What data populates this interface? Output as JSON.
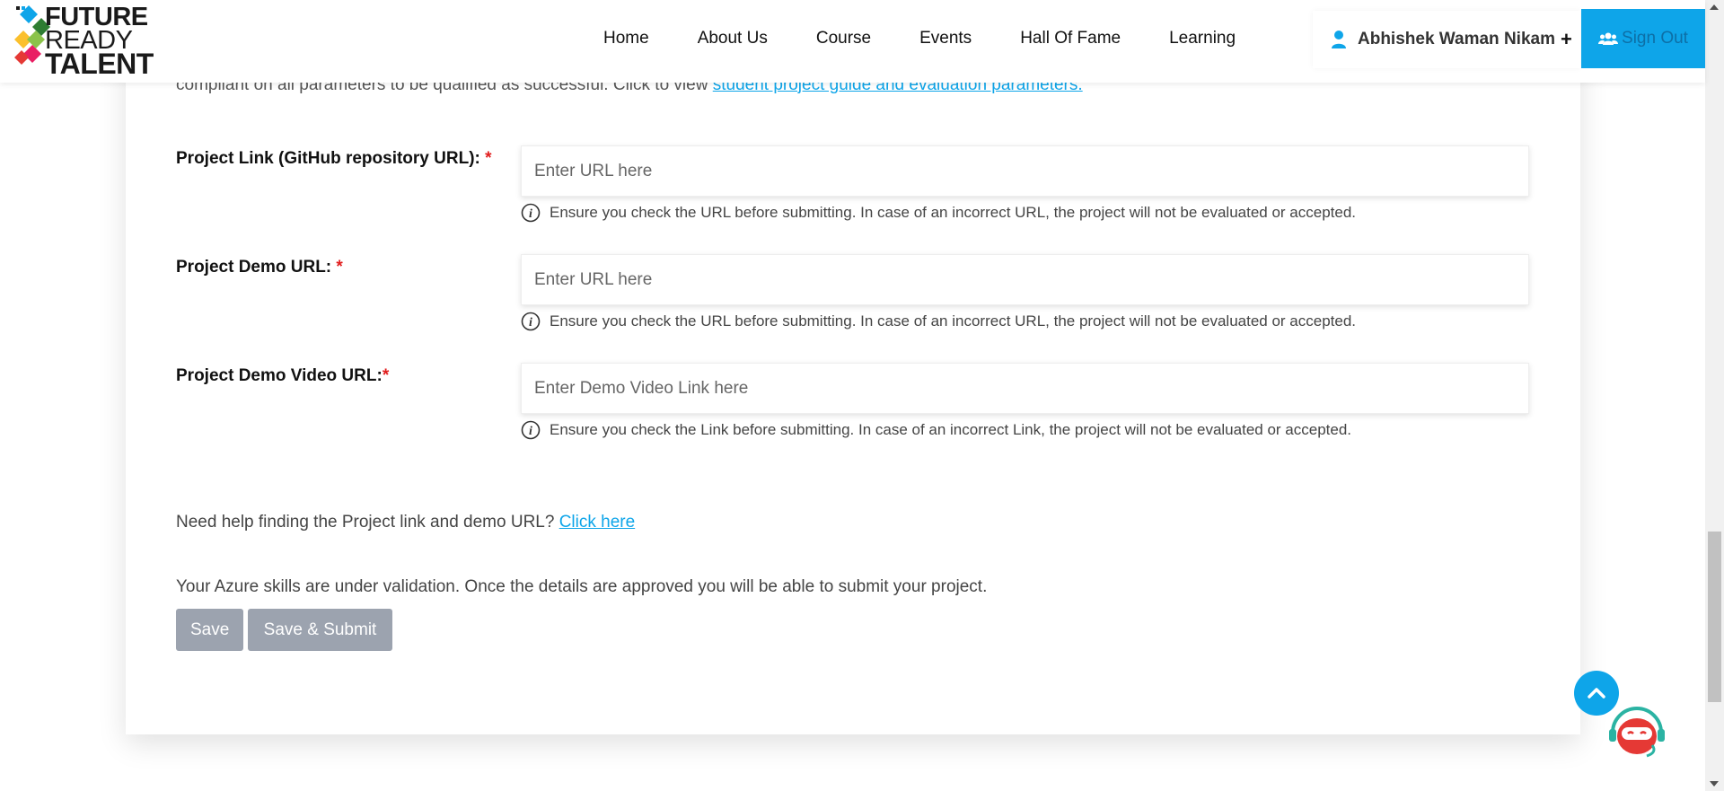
{
  "logo": {
    "line1": "FUTURE",
    "line2": "READY",
    "line3": "TALENT"
  },
  "nav": [
    "Home",
    "About Us",
    "Course",
    "Events",
    "Hall Of Fame",
    "Learning"
  ],
  "user": {
    "name": "Abhishek Waman Nikam",
    "plus": "+"
  },
  "signout": "Sign Out",
  "intro": {
    "text": "compliant on all parameters to be qualified as successful. Click to view ",
    "link": "student project guide and evaluation parameters."
  },
  "fields": [
    {
      "label": "Project Link (GitHub repository URL): ",
      "required": "*",
      "placeholder": "Enter URL here",
      "value": "",
      "hint": "Ensure you check the URL before submitting. In case of an incorrect URL, the project will not be evaluated or accepted."
    },
    {
      "label": "Project Demo URL: ",
      "required": "*",
      "placeholder": "Enter URL here",
      "value": "",
      "hint": "Ensure you check the URL before submitting. In case of an incorrect URL, the project will not be evaluated or accepted."
    },
    {
      "label": "Project Demo Video URL:",
      "required": "*",
      "placeholder": "Enter Demo Video Link here",
      "value": "",
      "hint": "Ensure you check the Link before submitting. In case of an incorrect Link, the project will not be evaluated or accepted."
    }
  ],
  "help": {
    "text": "Need help finding the Project link and demo URL? ",
    "link": "Click here"
  },
  "status": "Your Azure skills are under validation. Once the details are approved you will be able to submit your project.",
  "buttons": {
    "save": "Save",
    "save_submit": "Save & Submit"
  },
  "colors": {
    "accent": "#0ea5e9",
    "required": "#e11d1d",
    "button_disabled": "#9ca3af"
  }
}
